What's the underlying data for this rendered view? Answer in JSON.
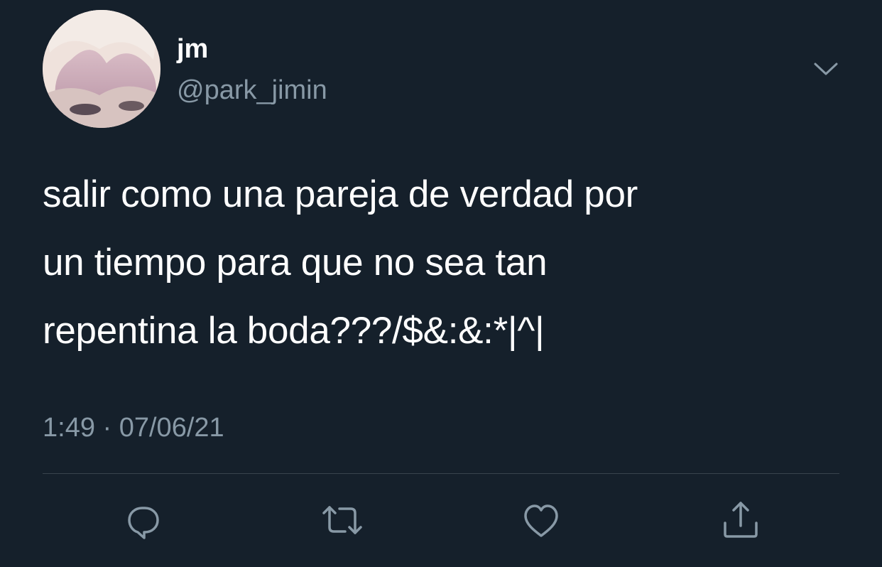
{
  "tweet": {
    "author": {
      "display_name": "jm",
      "handle": "@park_jimin"
    },
    "text": "salir como una pareja de verdad por\nun tiempo para que no sea tan\nrepentina la boda???/$&:&:*|^|",
    "timestamp": "1:49 · 07/06/21"
  },
  "actions": {
    "reply_icon": "speech-bubble-icon",
    "retweet_icon": "retweet-arrows-icon",
    "like_icon": "heart-icon",
    "share_icon": "share-upload-icon",
    "more_icon": "chevron-down-icon"
  },
  "colors": {
    "background": "#15202b",
    "primary_text": "#ffffff",
    "secondary_text": "#8899a6",
    "divider": "#38444d",
    "icon": "#8899a6"
  }
}
